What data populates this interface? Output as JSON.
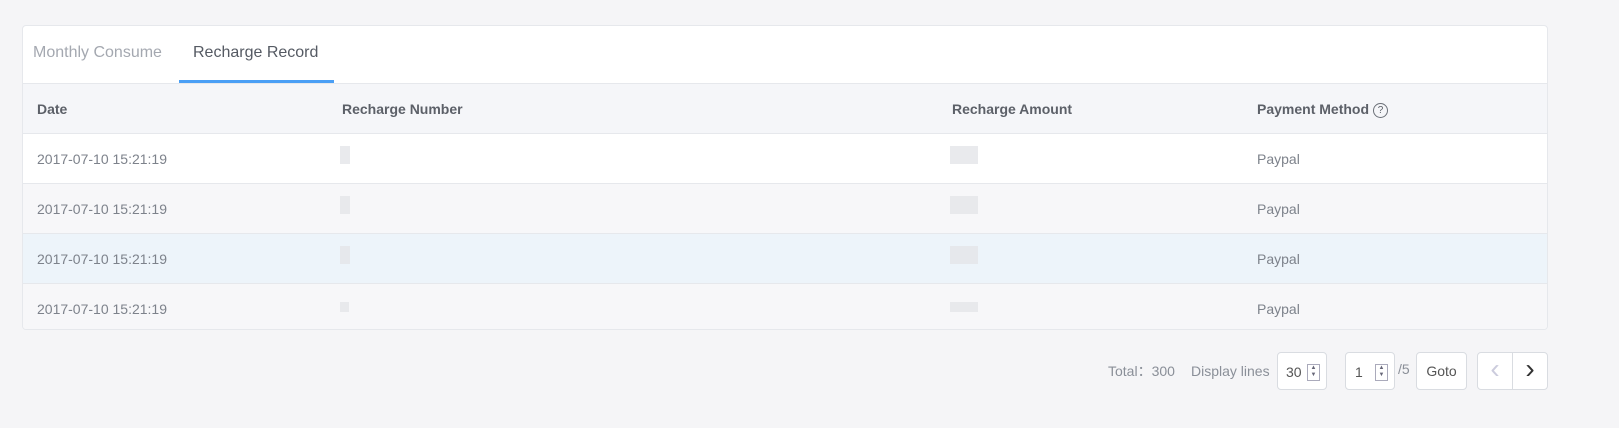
{
  "tabs": [
    {
      "label": "Monthly Consume"
    },
    {
      "label": "Recharge Record"
    }
  ],
  "table": {
    "headers": [
      "Date",
      "Recharge Number",
      "Recharge Amount",
      "Payment Method"
    ],
    "help_icon": "?",
    "rows": [
      {
        "date": "2017-07-10 15:21:19",
        "method": "Paypal"
      },
      {
        "date": "2017-07-10 15:21:19",
        "method": "Paypal"
      },
      {
        "date": "2017-07-10 15:21:19",
        "method": "Paypal"
      },
      {
        "date": "2017-07-10 15:21:19",
        "method": "Paypal"
      }
    ]
  },
  "pagination": {
    "total_label": "Total：300",
    "display_label": "Display lines",
    "page_size": "30",
    "page": "1",
    "page_count": "/5",
    "goto": "Goto",
    "prev": "‹",
    "next": "›"
  }
}
